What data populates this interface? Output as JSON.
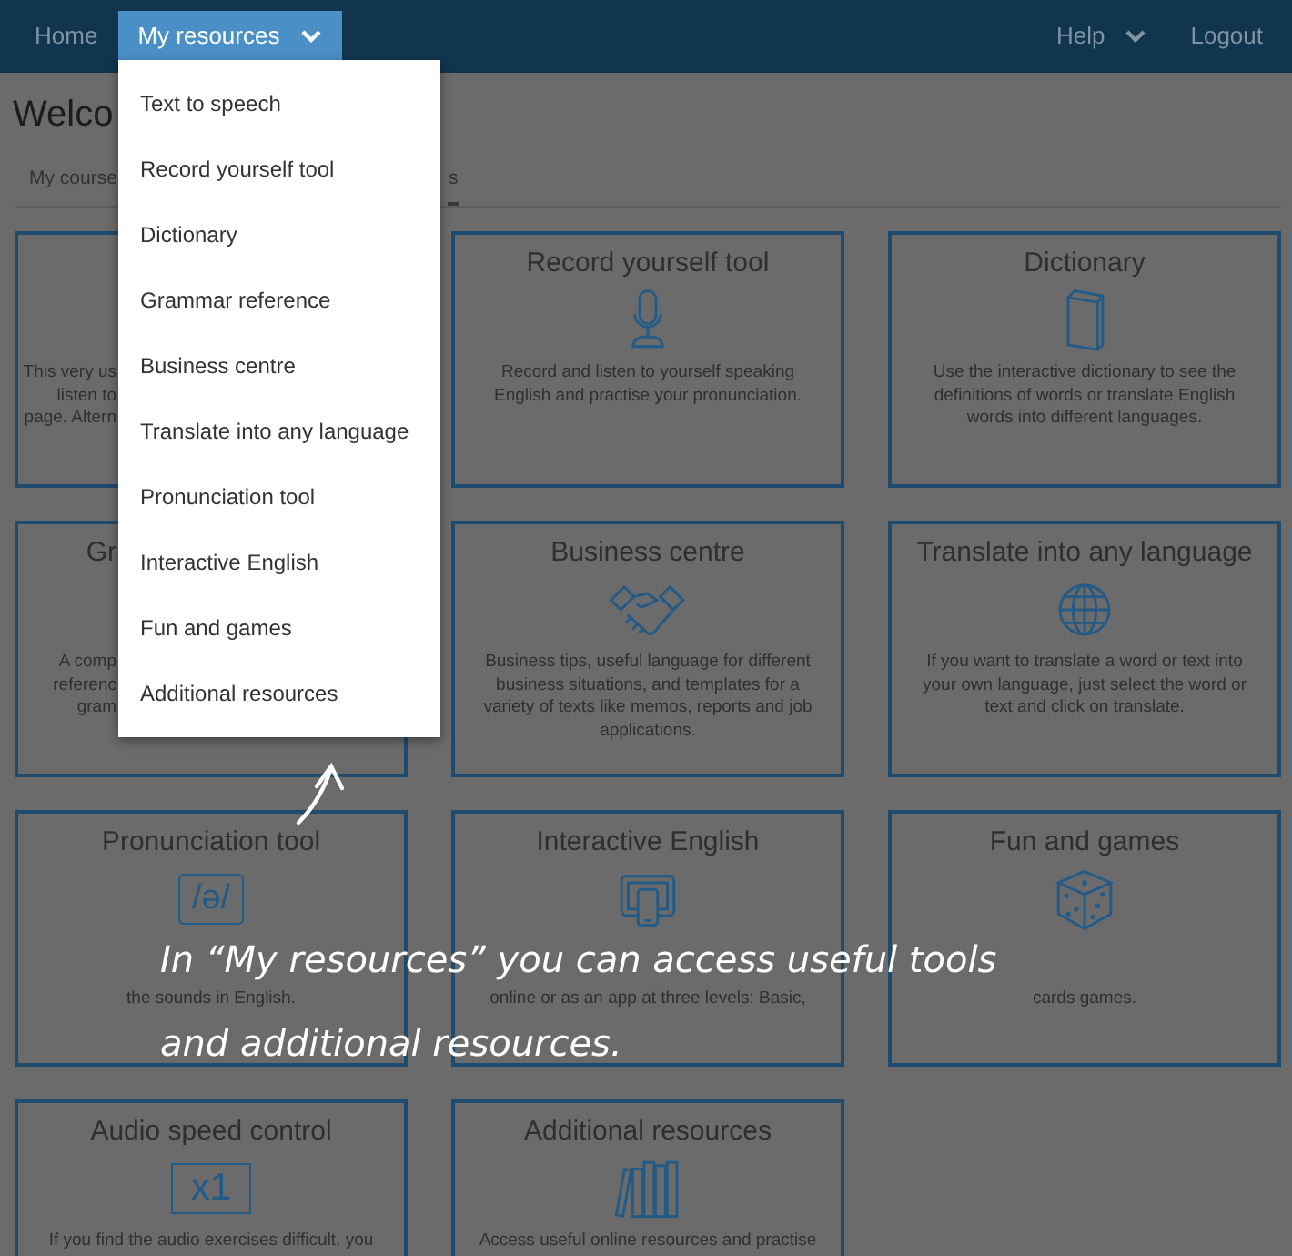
{
  "nav": {
    "items": [
      {
        "label": "Home",
        "selected": false
      },
      {
        "label": "My resources",
        "selected": true
      }
    ],
    "right_items": [
      {
        "label": "Help",
        "kind": "menu"
      },
      {
        "label": "Logout",
        "kind": "link"
      }
    ]
  },
  "dropdown": {
    "items": [
      {
        "label": "Text to speech"
      },
      {
        "label": "Record yourself tool"
      },
      {
        "label": "Dictionary"
      },
      {
        "label": "Grammar reference"
      },
      {
        "label": "Business centre"
      },
      {
        "label": "Translate into any language"
      },
      {
        "label": "Pronunciation tool"
      },
      {
        "label": "Interactive English"
      },
      {
        "label": "Fun and games"
      },
      {
        "label": "Additional resources"
      }
    ]
  },
  "page": {
    "title": "Welco",
    "tabs": [
      {
        "label": "My course",
        "selected": false
      },
      {
        "label": "s",
        "selected": true
      }
    ]
  },
  "cards": [
    {
      "covered": true,
      "lines": [
        "This very us",
        "listen to",
        "page. Altern"
      ]
    },
    {
      "covered": false,
      "title": "Record yourself tool",
      "lines": [
        "Record and listen to yourself speaking",
        "English and practise your pronunciation."
      ]
    },
    {
      "covered": false,
      "title": "Dictionary",
      "lines": [
        "Use the interactive dictionary to see the",
        "definitions of words or translate English",
        "words into different languages."
      ]
    },
    {
      "covered": true,
      "title": "Gr",
      "lines": [
        "A comp",
        "referenc",
        "gram"
      ]
    },
    {
      "covered": false,
      "title": "Business centre",
      "lines": [
        "Business tips, useful language for different",
        "business situations, and templates for a",
        "variety of texts like memos, reports and job",
        "applications."
      ]
    },
    {
      "covered": false,
      "title": "Translate into any language",
      "lines": [
        "If you want to translate a word or text into",
        "your own language, just select the word or",
        "text and click on translate."
      ]
    },
    {
      "covered": false,
      "title": "Pronunciation tool",
      "icon_text": "/ə/",
      "lines": [
        "the sounds in English."
      ]
    },
    {
      "covered": false,
      "title": "Interactive English",
      "lines": [
        "online or as an app at three levels: Basic,"
      ]
    },
    {
      "covered": false,
      "title": "Fun and games",
      "lines": [
        "cards games."
      ]
    },
    {
      "covered": false,
      "title": "Audio speed control",
      "icon_text": "x1",
      "lines": [
        "If you find the audio exercises difficult, you"
      ]
    },
    {
      "covered": false,
      "title": "Additional resources",
      "lines": [
        "Access useful online resources and practise"
      ]
    }
  ],
  "annotation": {
    "lines": [
      "In “My resources” you can access useful tools",
      "and additional resources."
    ]
  }
}
